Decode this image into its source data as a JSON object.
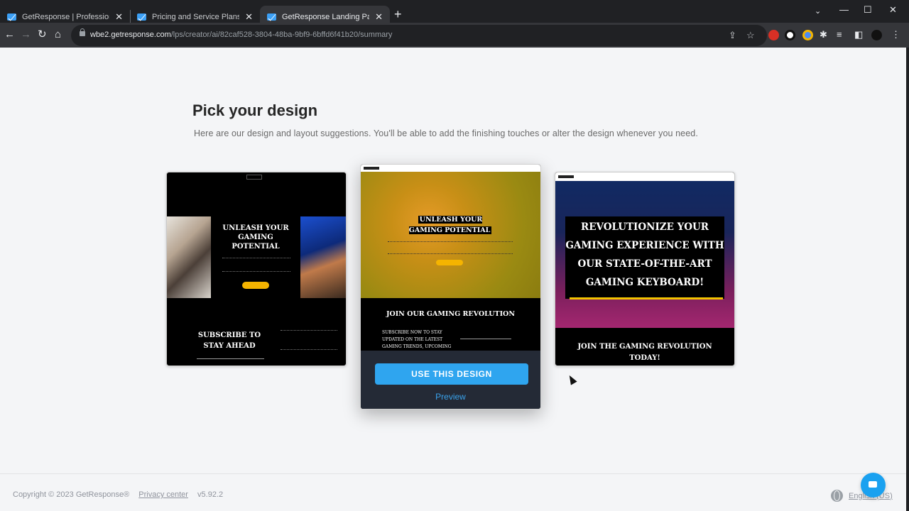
{
  "browser": {
    "tabs": [
      {
        "title": "GetResponse | Professional Email",
        "active": false
      },
      {
        "title": "Pricing and Service Plans | GetResponse",
        "active": false
      },
      {
        "title": "GetResponse Landing Pages",
        "active": true
      }
    ],
    "url_host": "wbe2.getresponse.com",
    "url_path": "/lps/creator/ai/82caf528-3804-48ba-9bf9-6bffd6f41b20/summary",
    "icons": [
      "back-icon",
      "forward-icon",
      "reload-icon",
      "home-icon",
      "share-icon",
      "star-icon",
      "extensions-icon",
      "sidebar-icon",
      "profile-icon",
      "menu-icon"
    ]
  },
  "page": {
    "title": "Pick your design",
    "subtitle": "Here are our design and layout suggestions. You'll be able to add the finishing touches or alter the design whenever you need."
  },
  "designs": [
    {
      "headline": "UNLEASH YOUR GAMING POTENTIAL",
      "section": "SUBSCRIBE TO STAY AHEAD"
    },
    {
      "headline": "UNLEASH YOUR GAMING POTENTIAL",
      "section": "JOIN OUR GAMING REVOLUTION",
      "sub": "SUBSCRIBE NOW TO STAY UPDATED ON THE LATEST GAMING TRENDS, UPCOMING",
      "use_button": "USE THIS DESIGN",
      "preview_link": "Preview"
    },
    {
      "headline": "REVOLUTIONIZE YOUR GAMING EXPERIENCE WITH OUR STATE-OF-THE-ART GAMING KEYBOARD!",
      "section": "JOIN THE GAMING REVOLUTION TODAY!"
    }
  ],
  "footer": {
    "copyright": "Copyright © 2023 GetResponse®",
    "privacy": "Privacy center",
    "version": "v5.92.2",
    "language": "English (US)"
  },
  "colors": {
    "accent": "#2fa5ef",
    "cta_yellow": "#f5b400",
    "chrome_dark": "#202124"
  }
}
